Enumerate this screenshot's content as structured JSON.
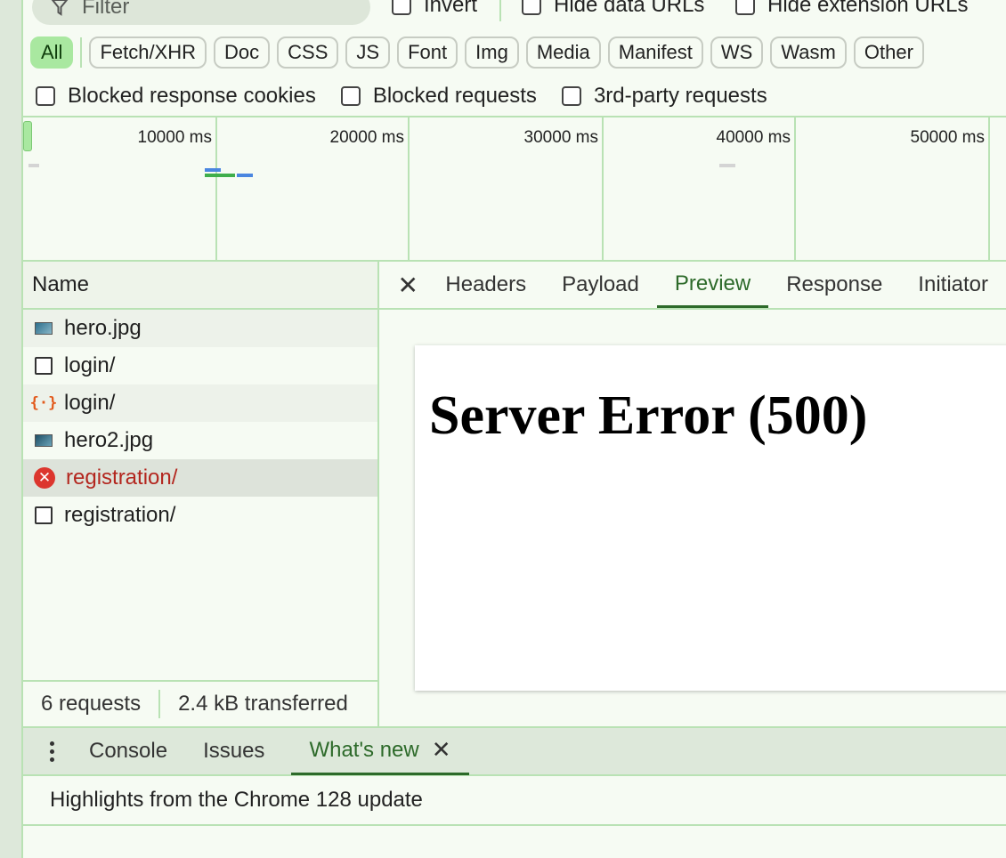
{
  "filter": {
    "placeholder": "Filter",
    "invert_label": "Invert",
    "hide_data_urls_label": "Hide data URLs",
    "hide_extension_urls_label": "Hide extension URLs"
  },
  "type_filters": [
    "All",
    "Fetch/XHR",
    "Doc",
    "CSS",
    "JS",
    "Font",
    "Img",
    "Media",
    "Manifest",
    "WS",
    "Wasm",
    "Other"
  ],
  "active_type_filter": "All",
  "blocked": {
    "cookies_label": "Blocked response cookies",
    "requests_label": "Blocked requests",
    "third_party_label": "3rd-party requests"
  },
  "timeline": {
    "ticks": [
      "10000 ms",
      "20000 ms",
      "30000 ms",
      "40000 ms",
      "50000 ms"
    ]
  },
  "requests": {
    "header": "Name",
    "rows": [
      {
        "name": "hero.jpg",
        "icon": "image-icon"
      },
      {
        "name": "login/",
        "icon": "document-icon"
      },
      {
        "name": "login/",
        "icon": "json-icon"
      },
      {
        "name": "hero2.jpg",
        "icon": "image-icon"
      },
      {
        "name": "registration/",
        "icon": "error-icon",
        "status": "error",
        "selected": true
      },
      {
        "name": "registration/",
        "icon": "document-icon"
      }
    ],
    "summary": {
      "count": "6 requests",
      "transferred": "2.4 kB transferred"
    }
  },
  "details": {
    "close_icon": "close-icon",
    "tabs": [
      "Headers",
      "Payload",
      "Preview",
      "Response",
      "Initiator"
    ],
    "active_tab": "Preview",
    "preview_heading": "Server Error (500)"
  },
  "drawer": {
    "tabs": [
      "Console",
      "Issues",
      "What's new"
    ],
    "active_tab": "What's new",
    "whats_new_text": "Highlights from the Chrome 128 update"
  },
  "colors": {
    "accent": "#2d6a2a",
    "chip_active": "#a9e8a0",
    "error": "#b3261e",
    "border": "#b9e2b4",
    "background": "#f6fbf3"
  }
}
